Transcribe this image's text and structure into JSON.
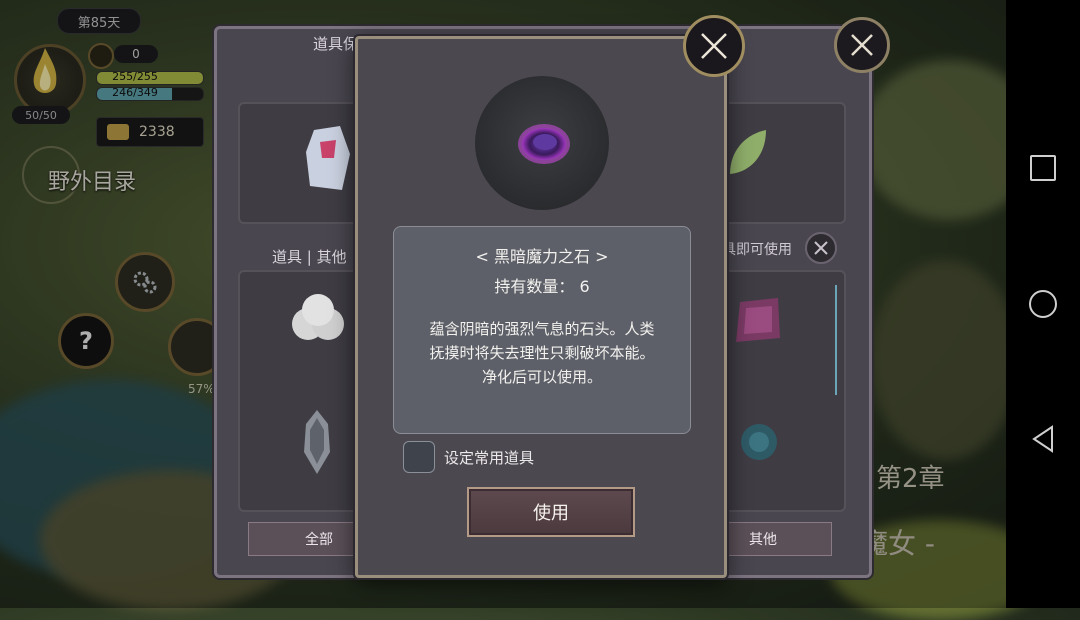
{
  "hud": {
    "day": "第85天",
    "calendar_count": "0",
    "hp": "255/255",
    "hp_fraction": 1.0,
    "mp": "246/349",
    "mp_fraction": 0.705,
    "stamina": "50/50",
    "gold": "2338",
    "field_catalog": "野外目录",
    "progress_pct": "57%"
  },
  "scene": {
    "chapter": "第2章",
    "witch_text": "的魔女 -"
  },
  "storage": {
    "title": "道具保管箱",
    "tab_label": "道具 | 其他",
    "hint": "具即可使用",
    "bottom_tabs": {
      "all": "全部",
      "other": "其他"
    }
  },
  "dialog": {
    "item_name": "< 黑暗魔力之石 >",
    "count_line": "持有数量： 6",
    "description": "蕴含阴暗的强烈气息的石头。人类\n抚摸时将失去理性只剩破坏本能。\n净化后可以使用。",
    "checkbox_label": "设定常用道具",
    "use_button": "使用"
  },
  "colors": {
    "accent_gold": "#a08d60",
    "stone_glow": "#c040e0",
    "hp": "#b3c04a",
    "mp": "#62a7b0"
  }
}
